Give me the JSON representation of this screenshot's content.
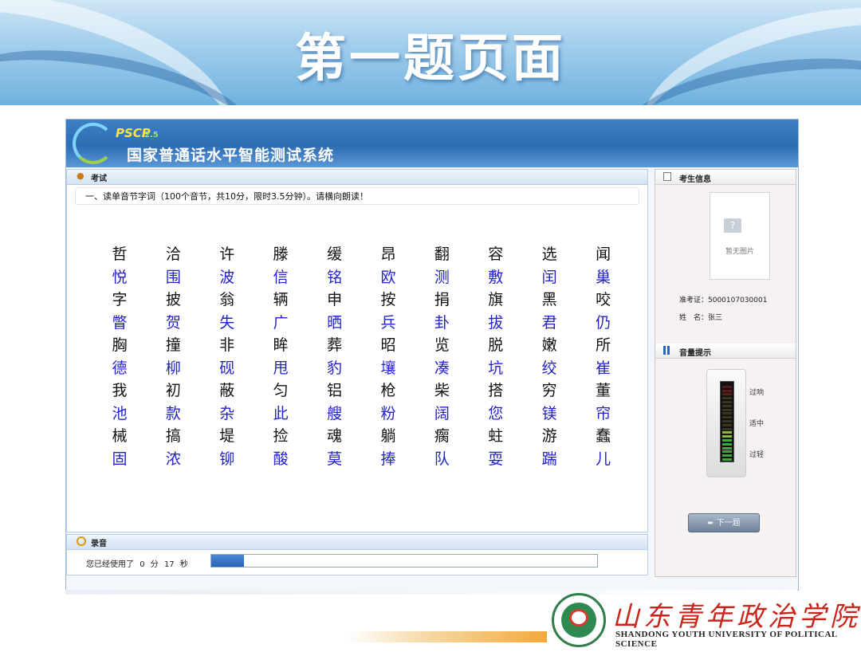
{
  "slide": {
    "title": "第一题页面"
  },
  "app": {
    "logo_text": "PSCP",
    "logo_sub": "2.5",
    "system_title": "国家普通话水平智能测试系统"
  },
  "exam": {
    "section_label": "考试",
    "instruction": "一、读单音节字词（100个音节，共10分，限时3.5分钟）。请横向朗读！",
    "rows": [
      [
        "哲",
        "洽",
        "许",
        "滕",
        "缓",
        "昂",
        "翻",
        "容",
        "选",
        "闻"
      ],
      [
        "悦",
        "围",
        "波",
        "信",
        "铭",
        "欧",
        "测",
        "敷",
        "闰",
        "巢"
      ],
      [
        "字",
        "披",
        "翁",
        "辆",
        "申",
        "按",
        "捐",
        "旗",
        "黑",
        "咬"
      ],
      [
        "瞥",
        "贺",
        "失",
        "广",
        "晒",
        "兵",
        "卦",
        "拔",
        "君",
        "仍"
      ],
      [
        "胸",
        "撞",
        "非",
        "眸",
        "葬",
        "昭",
        "览",
        "脱",
        "嫩",
        "所"
      ],
      [
        "德",
        "柳",
        "砚",
        "甩",
        "豹",
        "壤",
        "凑",
        "坑",
        "绞",
        "崔"
      ],
      [
        "我",
        "初",
        "蔽",
        "匀",
        "铝",
        "枪",
        "柴",
        "搭",
        "穷",
        "董"
      ],
      [
        "池",
        "款",
        "杂",
        "此",
        "艘",
        "粉",
        "阔",
        "您",
        "镁",
        "帘"
      ],
      [
        "械",
        "搞",
        "堤",
        "捡",
        "魂",
        "躺",
        "瘸",
        "蛀",
        "游",
        "蠢"
      ],
      [
        "固",
        "浓",
        "铆",
        "酸",
        "莫",
        "捧",
        "队",
        "耍",
        "踹",
        "儿"
      ]
    ]
  },
  "recording": {
    "label": "录音",
    "timer_prefix": "您已经使用了",
    "minutes": "0",
    "minutes_unit": "分",
    "seconds": "17",
    "seconds_unit": "秒",
    "progress_fraction": 0.085
  },
  "candidate": {
    "section_label": "考生信息",
    "photo_placeholder": "暂无图片",
    "id_line": "准考证：5000107030001",
    "name_line": "姓　名：张三"
  },
  "volume": {
    "section_label": "音量提示",
    "level_high": "过响",
    "level_mid": "适中",
    "level_low": "过轻",
    "level_fraction": 0.42
  },
  "next_button": {
    "label": "下一题"
  },
  "school": {
    "name_cn": "山东青年政治学院",
    "name_en": "SHANDONG YOUTH UNIVERSITY OF POLITICAL SCIENCE"
  },
  "colors": {
    "row_black": "#111111",
    "row_blue": "#2323c8",
    "banner": "#2d6db4"
  }
}
